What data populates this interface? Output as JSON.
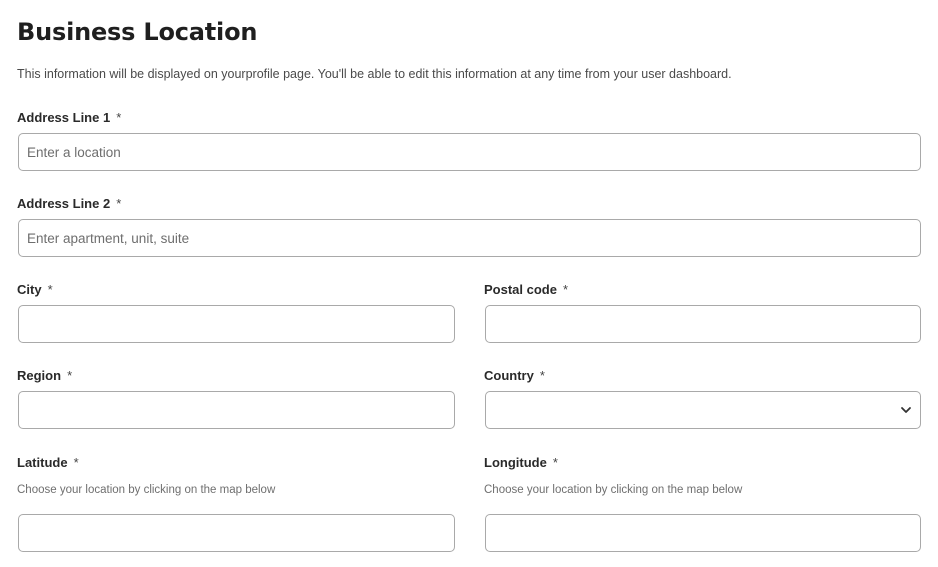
{
  "header": {
    "title": "Business Location",
    "description": "This information will be displayed on yourprofile page. You'll be able to edit this information at any time from your user dashboard."
  },
  "form": {
    "address_line_1": {
      "label": "Address Line 1",
      "required": "*",
      "placeholder": "Enter a location",
      "value": ""
    },
    "address_line_2": {
      "label": "Address Line 2",
      "required": "*",
      "placeholder": "Enter apartment, unit, suite",
      "value": ""
    },
    "city": {
      "label": "City",
      "required": "*",
      "value": ""
    },
    "postal_code": {
      "label": "Postal code",
      "required": "*",
      "value": ""
    },
    "region": {
      "label": "Region",
      "required": "*",
      "value": ""
    },
    "country": {
      "label": "Country",
      "required": "*",
      "selected": "",
      "icon": "chevron-down-icon"
    },
    "latitude": {
      "label": "Latitude",
      "required": "*",
      "hint": "Choose your location by clicking on the map below",
      "value": ""
    },
    "longitude": {
      "label": "Longitude",
      "required": "*",
      "hint": "Choose your location by clicking on the map below",
      "value": ""
    }
  },
  "colors": {
    "border": "#a9a9a9",
    "text": "#222222",
    "muted": "#6f6f6f"
  }
}
